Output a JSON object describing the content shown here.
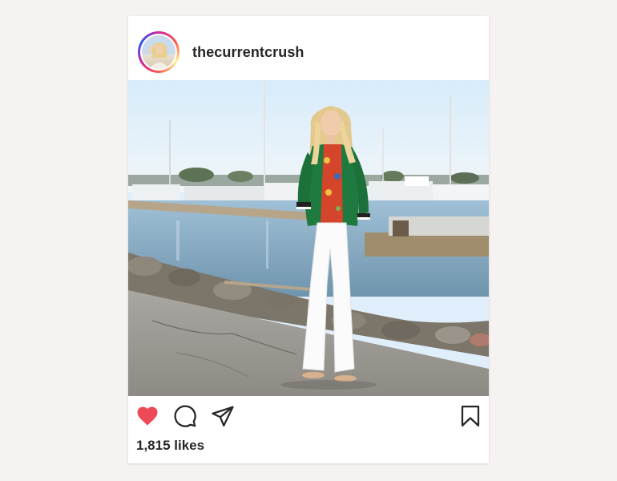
{
  "post": {
    "username": "thecurrentcrush",
    "likes_text": "1,815 likes",
    "liked": true
  },
  "icons": {
    "like": "heart-icon",
    "comment": "comment-icon",
    "share": "paper-plane-icon",
    "save": "bookmark-icon"
  },
  "colors": {
    "heart": "#ed4956",
    "text": "#262626",
    "background": "#f5f2f1"
  }
}
